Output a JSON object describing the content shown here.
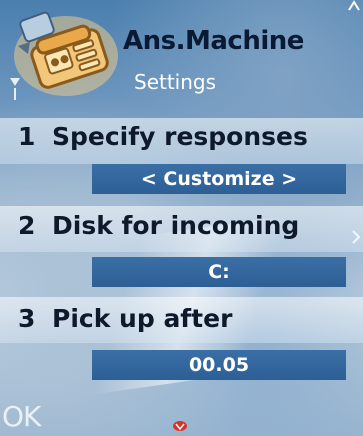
{
  "header": {
    "title": "Ans.Machine",
    "subtitle": "Settings",
    "app_icon": "answering-machine-icon"
  },
  "settings": [
    {
      "number": "1",
      "label": "Specify responses",
      "value": "< Customize >"
    },
    {
      "number": "2",
      "label": "Disk for incoming",
      "value": "C:"
    },
    {
      "number": "3",
      "label": "Pick up after",
      "value": "00.05"
    }
  ],
  "softkeys": {
    "left_label": "OK",
    "center_icon": "scroll-down-arrow-icon"
  },
  "colors": {
    "value_bar": "#3a6fa6",
    "title_text": "#0a1a34",
    "scroll_indicator": "#d8322a"
  }
}
